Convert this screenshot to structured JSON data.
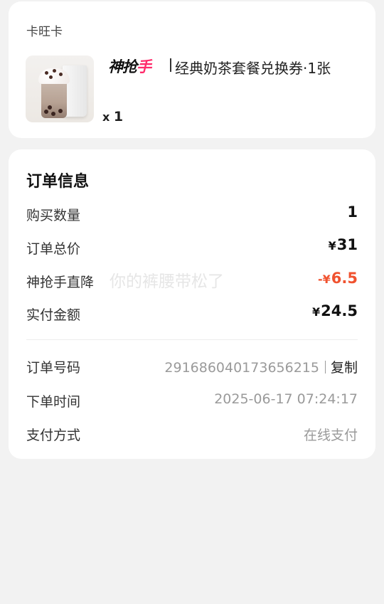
{
  "product": {
    "shop_name": "卡旺卡",
    "brand_logo_main": "神抢",
    "brand_logo_accent": "手",
    "title": "经典奶茶套餐兑换券·1张",
    "quantity_prefix": "x",
    "quantity": "1"
  },
  "order": {
    "section_title": "订单信息",
    "rows": [
      {
        "label": "购买数量",
        "value": "1"
      },
      {
        "label": "订单总价",
        "currency": "¥",
        "value": "31"
      },
      {
        "label": "神抢手直降",
        "currency": "-¥",
        "value": "6.5"
      },
      {
        "label": "实付金额",
        "currency": "¥",
        "value": "24.5"
      }
    ],
    "watermark": "你的裤腰带松了",
    "info": [
      {
        "label": "订单号码",
        "value": "291686040173656215",
        "action": "复制"
      },
      {
        "label": "下单时间",
        "value": "2025-06-17 07:24:17"
      },
      {
        "label": "支付方式",
        "value": "在线支付"
      }
    ]
  },
  "colors": {
    "discount": "#f0522f",
    "brand_accent": "#ff2a6a"
  }
}
